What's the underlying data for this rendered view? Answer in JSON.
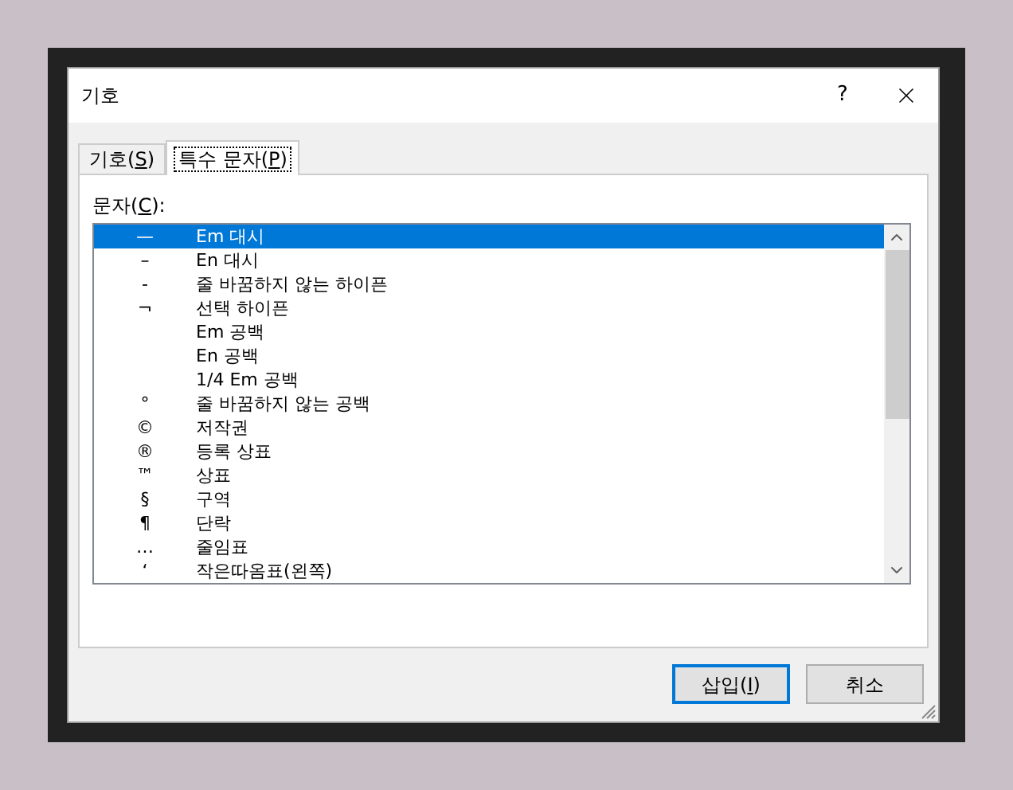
{
  "window": {
    "title": "기호",
    "help": "?"
  },
  "tabs": [
    {
      "before": "기호(",
      "mnemonic": "S",
      "after": ")",
      "selected": false
    },
    {
      "before": "특수 문자(",
      "mnemonic": "P",
      "after": ")",
      "selected": true
    }
  ],
  "list_label": {
    "before": "문자(",
    "mnemonic": "C",
    "after": "):"
  },
  "characters": [
    {
      "symbol": "—",
      "name": "Em 대시",
      "selected": true
    },
    {
      "symbol": "–",
      "name": "En 대시",
      "selected": false
    },
    {
      "symbol": "-",
      "name": "줄 바꿈하지 않는 하이픈",
      "selected": false
    },
    {
      "symbol": "¬",
      "name": "선택 하이픈",
      "selected": false
    },
    {
      "name": "Em 공백",
      "selected": false
    },
    {
      "name": "En 공백",
      "selected": false
    },
    {
      "name": "1/4 Em 공백",
      "selected": false
    },
    {
      "symbol": "°",
      "name": "줄 바꿈하지 않는 공백",
      "selected": false
    },
    {
      "symbol": "©",
      "name": "저작권",
      "selected": false
    },
    {
      "symbol": "®",
      "name": "등록 상표",
      "selected": false
    },
    {
      "symbol": "™",
      "name": "상표",
      "selected": false
    },
    {
      "symbol": "§",
      "name": "구역",
      "selected": false
    },
    {
      "symbol": "¶",
      "name": "단락",
      "selected": false
    },
    {
      "symbol": "…",
      "name": "줄임표",
      "selected": false
    },
    {
      "symbol": "‘",
      "name": "작은따옴표(왼쪽)",
      "selected": false
    }
  ],
  "buttons": [
    {
      "before": "삽입(",
      "mnemonic": "I",
      "after": ")",
      "default": true
    },
    {
      "before": "취소",
      "default": false
    }
  ]
}
